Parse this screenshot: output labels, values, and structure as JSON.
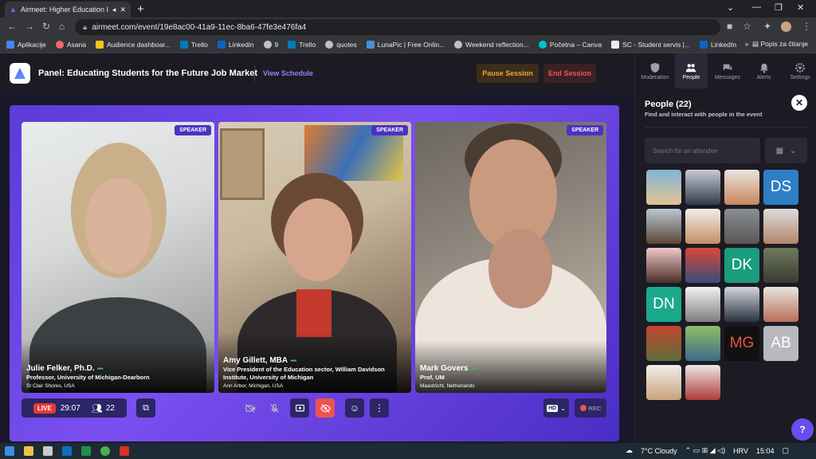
{
  "browser": {
    "tab_title": "Airmeet: Higher Education Ir",
    "url": "airmeet.com/event/19e8ac00-41a9-11ec-8ba6-47fe3e476fa4",
    "bookmarks": [
      "Aplikacije",
      "Asana",
      "Audience dashboar...",
      "Trello",
      "Linkedin",
      "9",
      "Trello",
      "quotes",
      "LunaPic | Free Onlin...",
      "Weekend reflection...",
      "Početna – Canva",
      "SC - Student servis |...",
      "LinkedIn"
    ],
    "reading_list": "Popis za čitanje"
  },
  "header": {
    "title": "Panel: Educating Students for the Future Job Market",
    "view_schedule": "View Schedule",
    "pause_label": "Pause Session",
    "end_label": "End Session"
  },
  "tiles": [
    {
      "badge": "SPEAKER",
      "name": "Julie Felker, Ph.D.",
      "role": "Professor, University of Michigan-Dearborn",
      "location": "St Clair Shores, USA"
    },
    {
      "badge": "SPEAKER",
      "name": "Amy Gillett, MBA",
      "role": "Vice President of the Education sector, William Davidson Institute, University of Michigan",
      "location": "Ann Arbor, Michigan, USA"
    },
    {
      "badge": "SPEAKER",
      "name": "Mark Govers",
      "role": "Prof, UM",
      "location": "Maastricht, Netherlands"
    }
  ],
  "controls": {
    "live": "LIVE",
    "timer": "29:07",
    "attendees": "22",
    "hd": "HD",
    "rec": "REC"
  },
  "panel": {
    "tabs": [
      "Moderation",
      "People",
      "Messages",
      "Alerts",
      "Settings"
    ],
    "active_tab": "People",
    "title": "People (22)",
    "subtitle": "Find and interact with people in the event",
    "search_placeholder": "Search for an attendee",
    "initials": [
      "DS",
      "DK",
      "DN",
      "MG",
      "AB"
    ]
  },
  "taskbar": {
    "weather": "7°C Cloudy",
    "lang": "HRV",
    "time": "15:04"
  }
}
